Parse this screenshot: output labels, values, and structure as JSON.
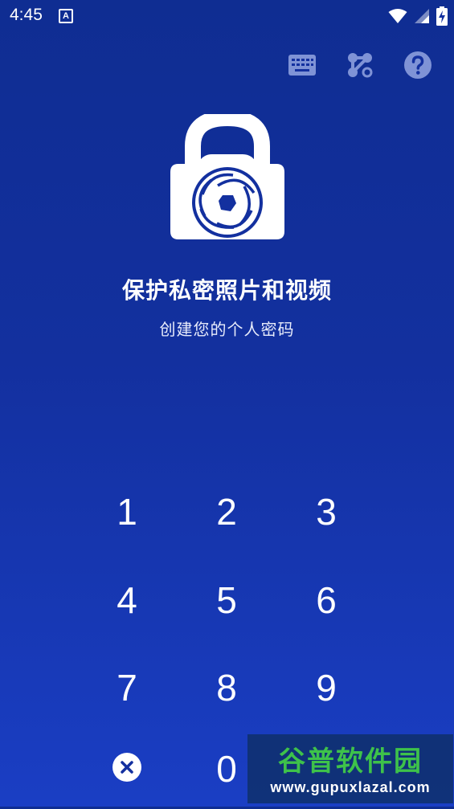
{
  "status_bar": {
    "time": "4:45",
    "notification_icon": "a-icon",
    "icons": [
      "wifi-icon",
      "signal-icon",
      "battery-icon"
    ]
  },
  "toolbar": {
    "icons": [
      "keyboard-icon",
      "pattern-icon",
      "help-icon"
    ]
  },
  "header": {
    "title": "保护私密照片和视频",
    "subtitle": "创建您的个人密码"
  },
  "keypad": {
    "keys": [
      "1",
      "2",
      "3",
      "4",
      "5",
      "6",
      "7",
      "8",
      "9",
      "0"
    ],
    "clear_icon": "close-icon"
  },
  "watermark": {
    "title": "谷普软件园",
    "url": "www.gupuxlazal.com"
  },
  "colors": {
    "background_top": "#0f2d92",
    "background_bottom": "#1a3ec4",
    "icon_muted": "#7f93d6",
    "watermark_green": "#3ec24a"
  }
}
